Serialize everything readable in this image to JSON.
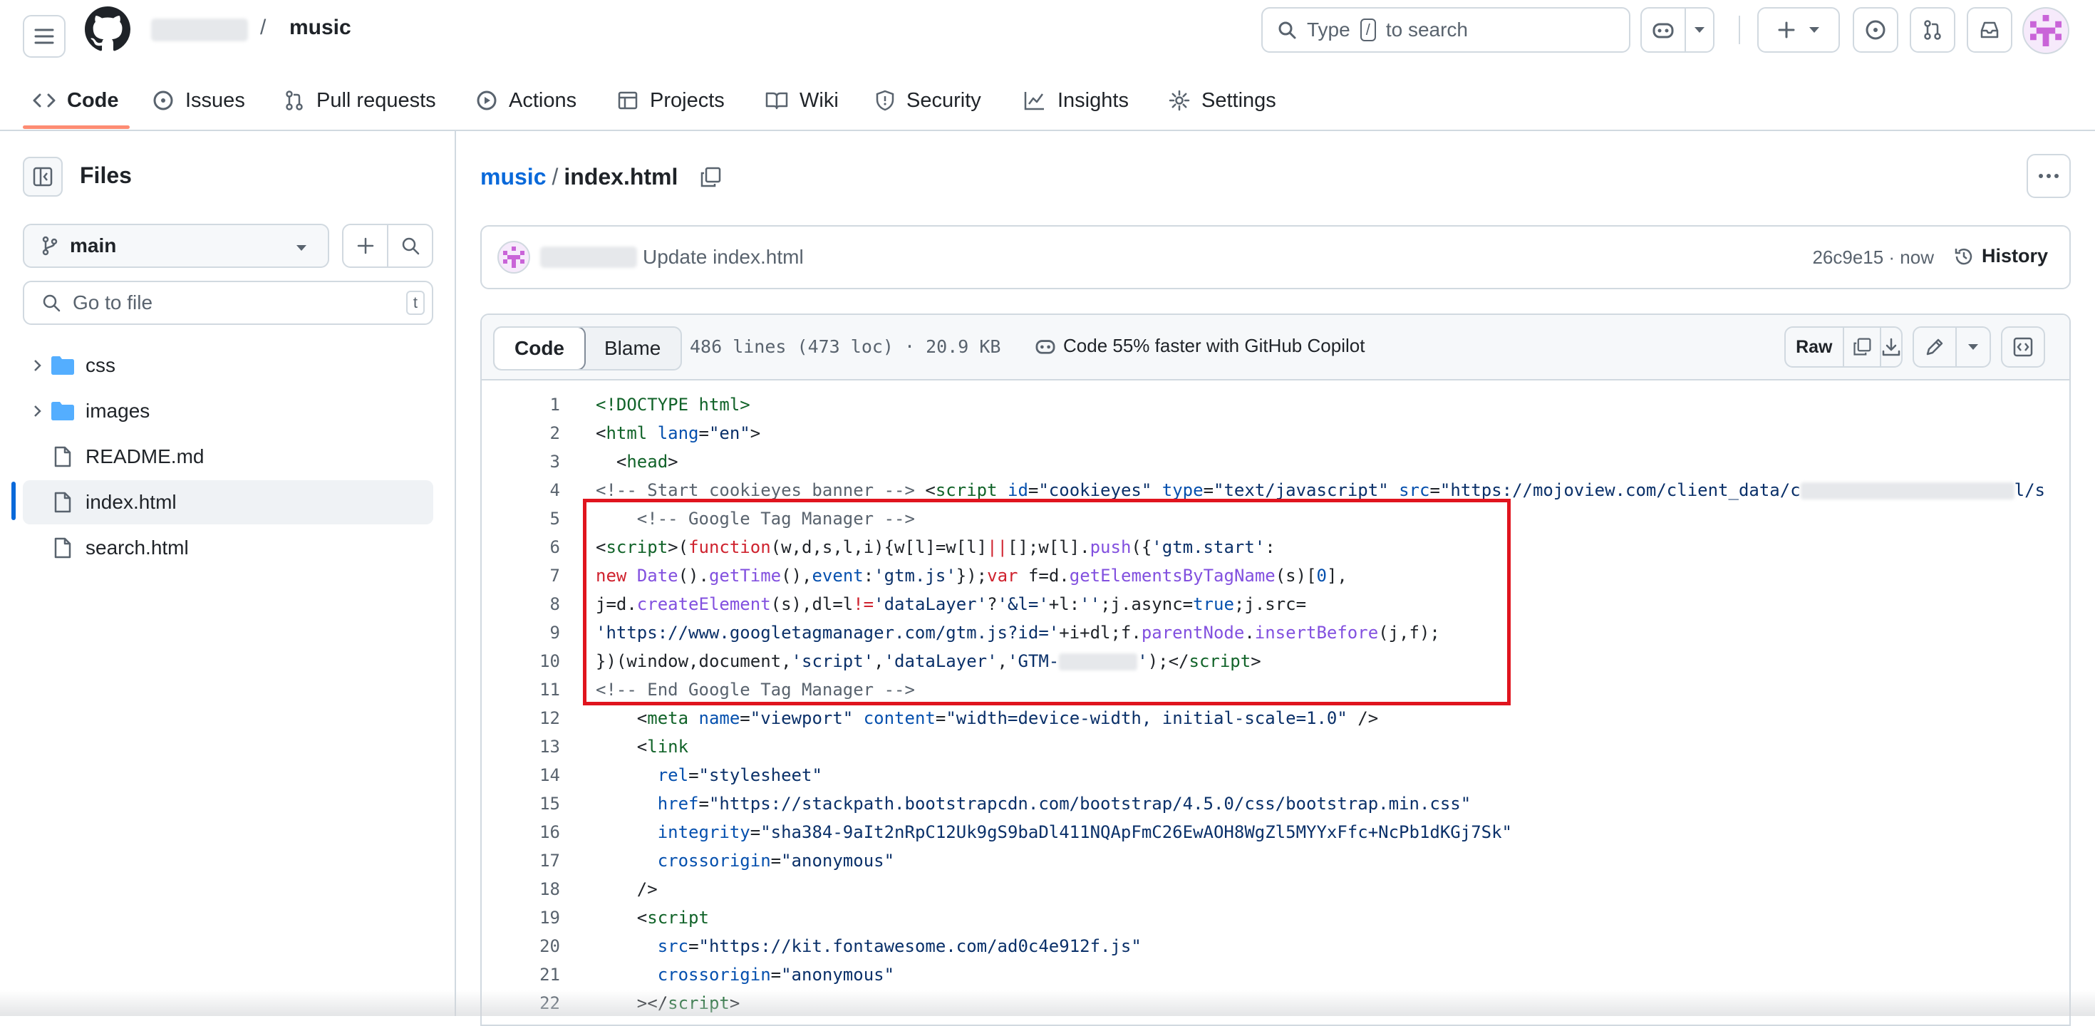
{
  "header": {
    "owner_name": "",
    "separator": "/",
    "repo_name": "music",
    "search_prefix": "Type",
    "search_key": "/",
    "search_suffix": "to search"
  },
  "repo_nav": {
    "tabs": [
      {
        "label": "Code",
        "icon": "code-icon",
        "active": true
      },
      {
        "label": "Issues",
        "icon": "issue-opened-icon"
      },
      {
        "label": "Pull requests",
        "icon": "git-pull-request-icon"
      },
      {
        "label": "Actions",
        "icon": "play-icon"
      },
      {
        "label": "Projects",
        "icon": "table-icon"
      },
      {
        "label": "Wiki",
        "icon": "book-icon"
      },
      {
        "label": "Security",
        "icon": "shield-icon"
      },
      {
        "label": "Insights",
        "icon": "graph-icon"
      },
      {
        "label": "Settings",
        "icon": "gear-icon"
      }
    ],
    "active_color": "#fd8c73"
  },
  "sidebar": {
    "title": "Files",
    "branch": "main",
    "goto_placeholder": "Go to file",
    "goto_shortcut": "t",
    "tree": [
      {
        "name": "css",
        "type": "folder"
      },
      {
        "name": "images",
        "type": "folder"
      },
      {
        "name": "README.md",
        "type": "file"
      },
      {
        "name": "index.html",
        "type": "file",
        "selected": true
      },
      {
        "name": "search.html",
        "type": "file"
      }
    ]
  },
  "file": {
    "repo_link": "music",
    "separator": "/",
    "name": "index.html",
    "commit_message": "Update index.html",
    "commit_meta": "26c9e15 · now",
    "history_label": "History",
    "tab_code": "Code",
    "tab_blame": "Blame",
    "info": "486 lines (473 loc) · 20.9 KB",
    "copilot_promo": "Code 55% faster with GitHub Copilot",
    "raw_label": "Raw"
  },
  "code": {
    "line_numbers": [
      "1",
      "2",
      "3",
      "4",
      "5",
      "6",
      "7",
      "8",
      "9",
      "10",
      "11",
      "12",
      "13",
      "14",
      "15",
      "16",
      "17",
      "18",
      "19",
      "20",
      "21",
      "22"
    ],
    "highlight_color": "#e0141e"
  },
  "colors": {
    "link": "#0969da",
    "border": "#d1d9e0",
    "muted": "#59636e",
    "tag": "#116329",
    "attr": "#0550ae",
    "string": "#0a3069",
    "keyword": "#cf222e",
    "function": "#8250df"
  }
}
